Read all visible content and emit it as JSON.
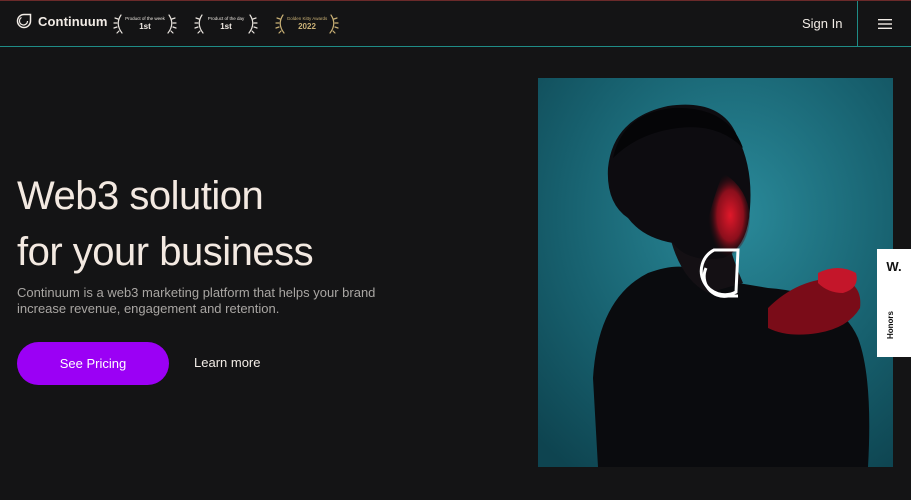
{
  "header": {
    "logo_text": "Continuum",
    "awards": [
      {
        "label": "Product of the week",
        "rank": "1st"
      },
      {
        "label": "Product of the day",
        "rank": "1st"
      },
      {
        "label": "Golden Kitty Awards",
        "rank": "2022"
      }
    ],
    "sign_in": "Sign In",
    "menu_icon": "hamburger-menu-icon"
  },
  "hero": {
    "title_line1": "Web3 solution",
    "title_line2": "for your business",
    "description": "Continuum is a web3 marketing platform that helps your brand increase revenue, engagement and retention.",
    "primary_button": "See Pricing",
    "secondary_link": "Learn more"
  },
  "honors_badge": {
    "letter": "W.",
    "label": "Honors"
  },
  "colors": {
    "background": "#141415",
    "accent_purple": "#9b00f5",
    "teal_line": "#1f8c86",
    "image_teal": "#1b6f80",
    "image_red": "#d11a2a"
  }
}
